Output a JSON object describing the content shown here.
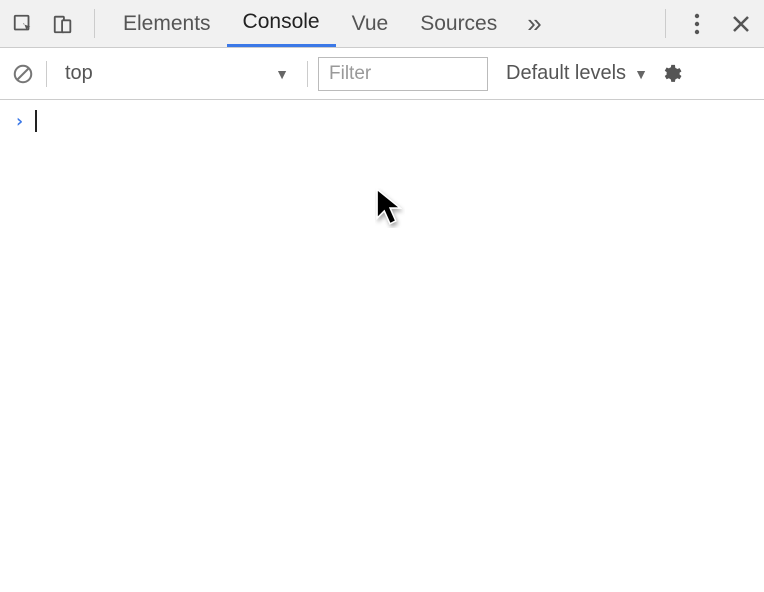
{
  "tabs": {
    "elements": "Elements",
    "console": "Console",
    "vue": "Vue",
    "sources": "Sources"
  },
  "subbar": {
    "context": "top",
    "filter_placeholder": "Filter",
    "levels": "Default levels"
  }
}
